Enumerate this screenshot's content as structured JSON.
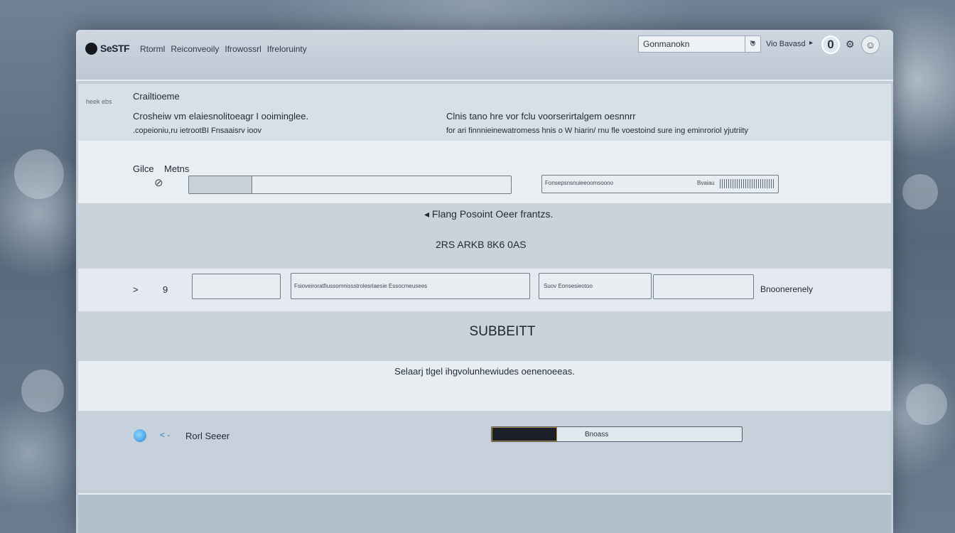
{
  "header": {
    "logo_text": "SeSTF",
    "nav": [
      "Rtorml",
      "Reiconveoily",
      "Ifrowossrl",
      "Ifreloruinty"
    ],
    "search_value": "Gonmanokn",
    "search_sync_icon": "refresh-icon",
    "user_link": "Vio Bavasd",
    "avatar_letter": "0"
  },
  "info": {
    "side_label": "heek ebs",
    "title": "Crailtioeme",
    "left_line1": "Crosheiw vm elaiesnolitoeagr I ooiminglee.",
    "left_line2": ".copeioniu,ru ietrootBI Fnsaaisrv ioov",
    "right_line1": "Clnis tano hre vor fclu voorserirtalgem oesnnrr",
    "right_line2": "for ari finnnieinewatromess hnis o W hiarin/ rnu fle voestoind sure ing eminroriol yjutriity"
  },
  "form1": {
    "label_a": "Gilce",
    "label_b": "Metns",
    "field2_placeholder": "Fonsepsnsnuieeoomsoono",
    "field2_suffix": "Bvaiau"
  },
  "middle": {
    "back_link": "Flang Posoint  Oeer frantzs.",
    "code": "2RS ARKB  8K6 0AS"
  },
  "form2": {
    "lead_a": ">",
    "lead_b": "9",
    "field2_placeholder": "Fsioveiroratfiussomnissstrolesrlaesie  Essocmeusees",
    "field3_placeholder": "Suov Eonsesieotoo",
    "trailing_text": "Bnoonerenely"
  },
  "submit_label": "SUBBEITT",
  "notice": "Selaarj tlgel ihgvolunhewiudes oenenoeeas.",
  "footer": {
    "left_label": "Rorl Seeer",
    "progress_fraction": 0.26,
    "progress_label": "Bnoass"
  }
}
